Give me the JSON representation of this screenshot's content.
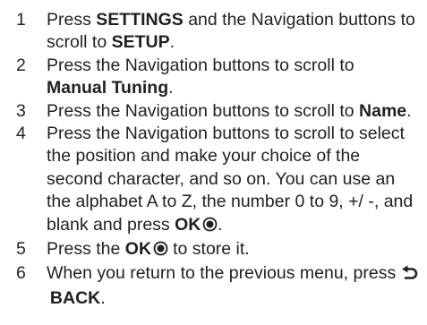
{
  "steps": [
    {
      "number": "1",
      "t1": "Press ",
      "b1": "SETTINGS",
      "t2": " and the Navigation buttons to scroll to ",
      "b2": "SETUP",
      "t3": "."
    },
    {
      "number": "2",
      "t1": "Press the Navigation buttons to scroll to ",
      "b1": "Manual Tuning",
      "t2": "."
    },
    {
      "number": "3",
      "t1": "Press the Navigation buttons to scroll to ",
      "b1": "Name",
      "t2": "."
    },
    {
      "number": "4",
      "t1": "Press the Navigation buttons to scroll to select the position and make your choice of the second character, and so on. You can use an the alphabet A to Z, the number 0 to 9, +/ -, and blank and press ",
      "b1": "OK",
      "icon": "ok-button-icon",
      "t2": "."
    },
    {
      "number": "5",
      "t1": "Press the ",
      "b1": "OK",
      "icon": "ok-button-icon",
      "t2": " to store it."
    },
    {
      "number": "6",
      "t1": "When you return to the previous menu, press ",
      "icon": "back-arrow-icon",
      "b1": "BACK",
      "t2": "."
    }
  ]
}
